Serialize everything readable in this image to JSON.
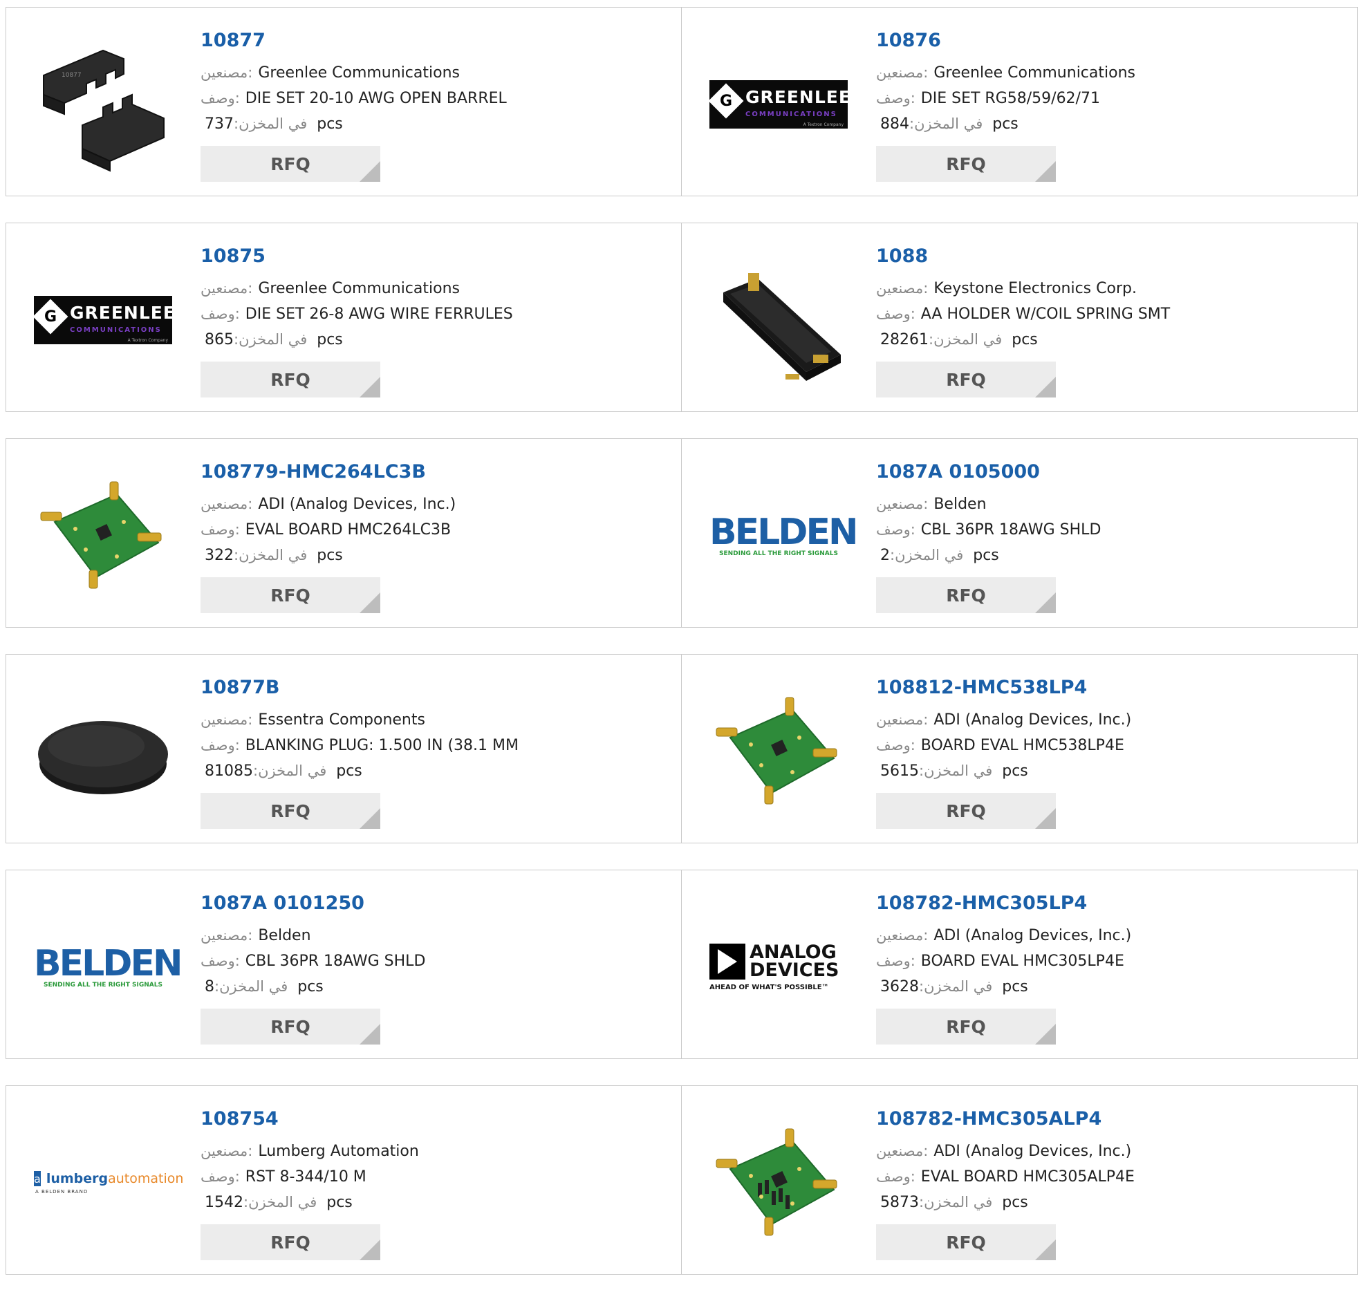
{
  "labels": {
    "manufacturer": "مصنعين:",
    "description": "وصف:",
    "in_stock": "في المخزن:",
    "unit": "pcs",
    "rfq": "RFQ"
  },
  "products": [
    {
      "part": "10877",
      "manufacturer": "Greenlee Communications",
      "description": "DIE SET 20-10 AWG OPEN BARREL",
      "stock": "737",
      "image": "crimp-die-image"
    },
    {
      "part": "10876",
      "manufacturer": "Greenlee Communications",
      "description": "DIE SET RG58/59/62/71",
      "stock": "884",
      "image": "greenlee-logo"
    },
    {
      "part": "10875",
      "manufacturer": "Greenlee Communications",
      "description": "DIE SET 26-8 AWG WIRE FERRULES",
      "stock": "865",
      "image": "greenlee-logo"
    },
    {
      "part": "1088",
      "manufacturer": "Keystone Electronics Corp.",
      "description": "AA HOLDER W/COIL SPRING SMT",
      "stock": "28261",
      "image": "battery-holder-image"
    },
    {
      "part": "108779-HMC264LC3B",
      "manufacturer": "ADI (Analog Devices, Inc.)",
      "description": "EVAL BOARD HMC264LC3B",
      "stock": "322",
      "image": "eval-board-image"
    },
    {
      "part": "1087A 0105000",
      "manufacturer": "Belden",
      "description": "CBL 36PR 18AWG SHLD",
      "stock": "2",
      "image": "belden-logo"
    },
    {
      "part": "10877B",
      "manufacturer": "Essentra Components",
      "description": "BLANKING PLUG: 1.500 IN (38.1 MM",
      "stock": "81085",
      "image": "blanking-plug-image"
    },
    {
      "part": "108812-HMC538LP4",
      "manufacturer": "ADI (Analog Devices, Inc.)",
      "description": "BOARD EVAL HMC538LP4E",
      "stock": "5615",
      "image": "eval-board-image"
    },
    {
      "part": "1087A 0101250",
      "manufacturer": "Belden",
      "description": "CBL 36PR 18AWG SHLD",
      "stock": "8",
      "image": "belden-logo"
    },
    {
      "part": "108782-HMC305LP4",
      "manufacturer": "ADI (Analog Devices, Inc.)",
      "description": "BOARD EVAL HMC305LP4E",
      "stock": "3628",
      "image": "analog-devices-logo"
    },
    {
      "part": "108754",
      "manufacturer": "Lumberg Automation",
      "description": "RST 8-344/10 M",
      "stock": "1542",
      "image": "lumberg-logo"
    },
    {
      "part": "108782-HMC305ALP4",
      "manufacturer": "ADI (Analog Devices, Inc.)",
      "description": "EVAL BOARD HMC305ALP4E",
      "stock": "5873",
      "image": "eval-board-large-image"
    }
  ],
  "logos": {
    "greenlee": {
      "name": "GREENLEE",
      "sub": "COMMUNICATIONS",
      "tiny": "A Textron Company",
      "letter": "G"
    },
    "belden": {
      "name": "BELDEN",
      "sub": "SENDING ALL THE RIGHT SIGNALS"
    },
    "analog": {
      "line1": "ANALOG",
      "line2": "DEVICES",
      "sub": "AHEAD OF WHAT'S POSSIBLE™"
    },
    "lumberg": {
      "box": "a",
      "part1": "lumberg",
      "part2": "automation",
      "sub": "A BELDEN BRAND"
    }
  },
  "colors": {
    "link": "#1a5fa8",
    "border": "#c9c9c9",
    "rfq_bg": "#ececec"
  }
}
